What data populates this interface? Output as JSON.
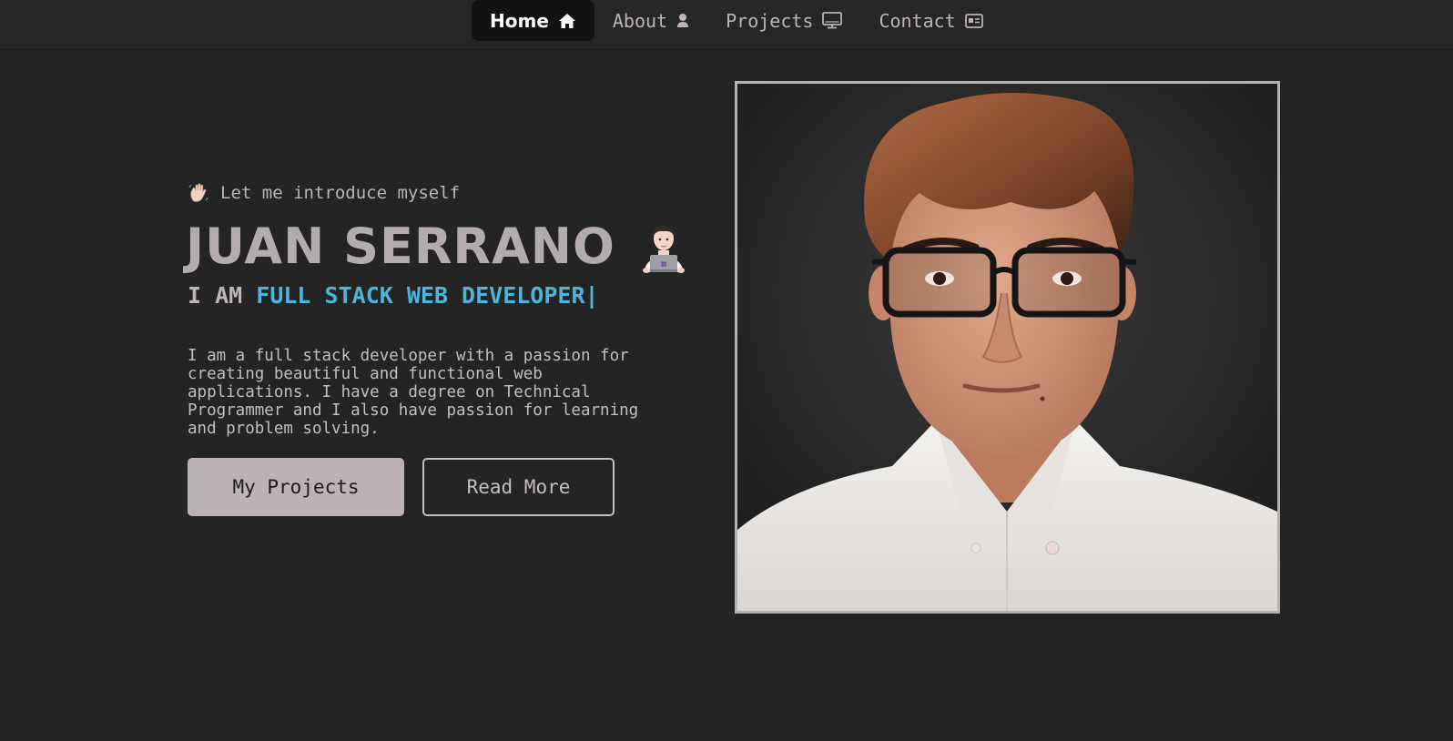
{
  "nav": {
    "items": [
      {
        "label": "Home",
        "icon": "home-icon",
        "active": true
      },
      {
        "label": "About",
        "icon": "user-icon",
        "active": false
      },
      {
        "label": "Projects",
        "icon": "monitor-icon",
        "active": false
      },
      {
        "label": "Contact",
        "icon": "id-card-icon",
        "active": false
      }
    ]
  },
  "hero": {
    "intro": "Let me introduce myself",
    "name": "JUAN SERRANO",
    "role_prefix": "I AM",
    "role_typed": "FULL STACK WEB DEVELOPER|",
    "description": "I am a full stack developer with a passion for creating beautiful and functional web applications. I have a degree on Technical Programmer and I also have passion for learning and problem solving.",
    "primary_button": "My Projects",
    "secondary_button": "Read More"
  },
  "colors": {
    "background": "#242424",
    "accent": "#4fb3da",
    "text": "#bcb4b7",
    "active_nav_bg": "#121212"
  }
}
